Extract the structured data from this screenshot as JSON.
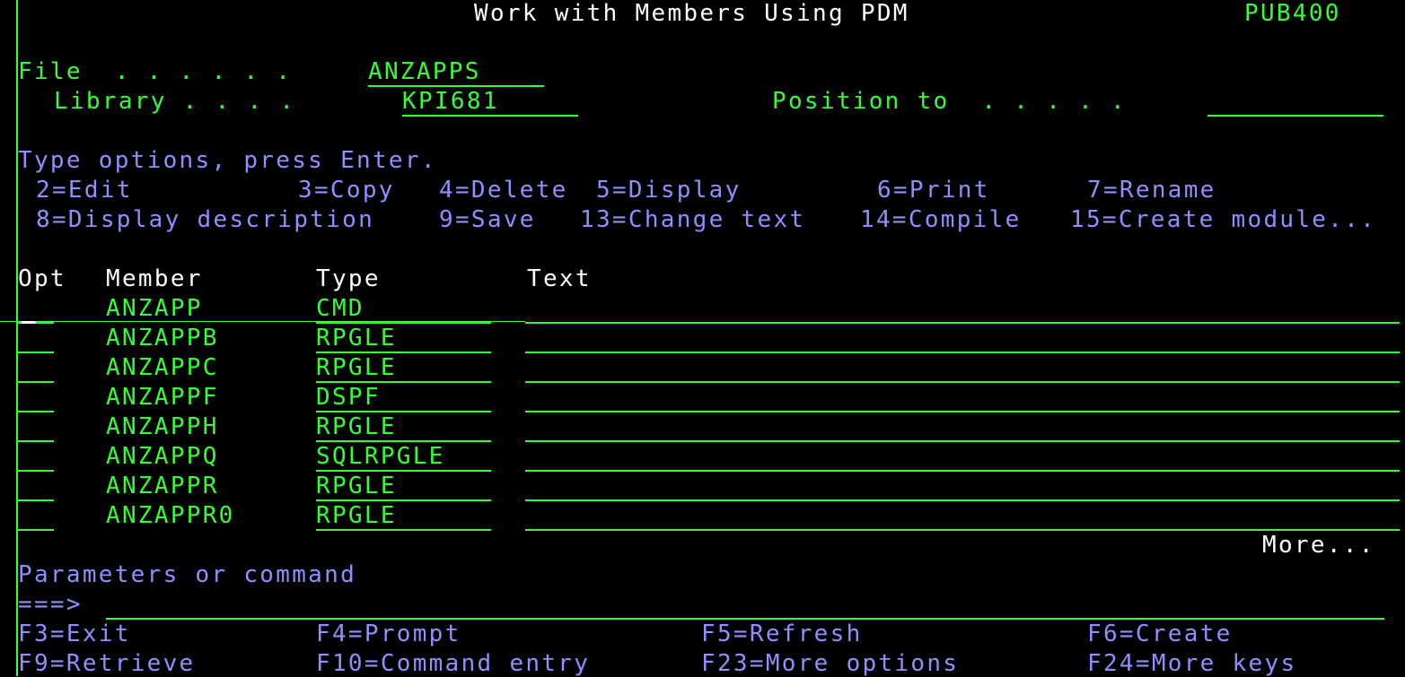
{
  "screen": {
    "title": "Work with Members Using PDM",
    "system": "PUB400"
  },
  "file_field": {
    "label": "File  . . . . . .",
    "value": "ANZAPPS"
  },
  "library_field": {
    "label": "Library . . . .",
    "value": "KPI681"
  },
  "position_to": {
    "label": "Position to  . . . . .",
    "value": ""
  },
  "instructions": "Type options, press Enter.",
  "options": [
    "2=Edit",
    "3=Copy",
    "4=Delete",
    "5=Display",
    "6=Print",
    "7=Rename",
    "8=Display description",
    "9=Save",
    "13=Change text",
    "14=Compile",
    "15=Create module..."
  ],
  "columns": {
    "opt": "Opt",
    "member": "Member",
    "type": "Type",
    "text": "Text"
  },
  "rows": [
    {
      "opt": "",
      "member": "ANZAPP",
      "type": "CMD",
      "text": ""
    },
    {
      "opt": "",
      "member": "ANZAPPB",
      "type": "RPGLE",
      "text": ""
    },
    {
      "opt": "",
      "member": "ANZAPPC",
      "type": "RPGLE",
      "text": ""
    },
    {
      "opt": "",
      "member": "ANZAPPF",
      "type": "DSPF",
      "text": ""
    },
    {
      "opt": "",
      "member": "ANZAPPH",
      "type": "RPGLE",
      "text": ""
    },
    {
      "opt": "",
      "member": "ANZAPPQ",
      "type": "SQLRPGLE",
      "text": ""
    },
    {
      "opt": "",
      "member": "ANZAPPR",
      "type": "RPGLE",
      "text": ""
    },
    {
      "opt": "",
      "member": "ANZAPPR0",
      "type": "RPGLE",
      "text": ""
    }
  ],
  "more": "More...",
  "command": {
    "label": "Parameters or command",
    "prompt": "===>",
    "value": ""
  },
  "function_keys": [
    "F3=Exit",
    "F4=Prompt",
    "F5=Refresh",
    "F6=Create",
    "F9=Retrieve",
    "F10=Command entry",
    "F23=More options",
    "F24=More keys"
  ],
  "colors": {
    "background": "#000000",
    "field_green": "#33ff33",
    "label_blue": "#8f8fff",
    "heading_white": "#ffffff"
  }
}
